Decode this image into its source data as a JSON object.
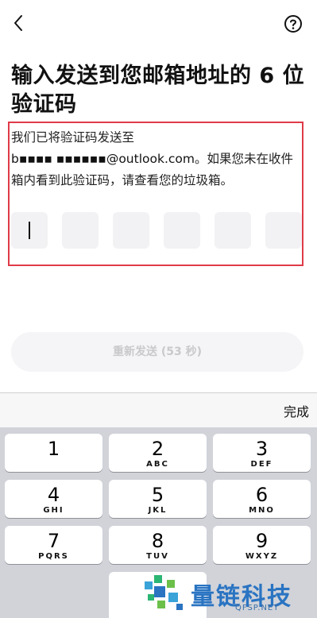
{
  "header": {
    "back_icon": "chevron-left-icon",
    "help_icon": "question-circle-icon"
  },
  "title": "输入发送到您邮箱地址的 6 位验证码",
  "description": {
    "line1": "我们已将验证码发送至",
    "email": "b▪▪▪▪ ▪▪▪▪▪▪@outlook.com",
    "rest": "。如果您未在收件箱内看到此验证码，请查看您的垃圾箱。"
  },
  "otp": {
    "length": 6,
    "values": [
      "",
      "",
      "",
      "",
      "",
      ""
    ],
    "focused_index": 0
  },
  "resend": {
    "label": "重新发送 (53 秒)"
  },
  "keyboard": {
    "done_label": "完成",
    "keys": [
      {
        "num": "1",
        "letters": ""
      },
      {
        "num": "2",
        "letters": "ABC"
      },
      {
        "num": "3",
        "letters": "DEF"
      },
      {
        "num": "4",
        "letters": "GHI"
      },
      {
        "num": "5",
        "letters": "JKL"
      },
      {
        "num": "6",
        "letters": "MNO"
      },
      {
        "num": "7",
        "letters": "PQRS"
      },
      {
        "num": "8",
        "letters": "TUV"
      },
      {
        "num": "9",
        "letters": "WXYZ"
      }
    ]
  },
  "watermark": {
    "text": "量链科技",
    "url": "QFSP.NET"
  },
  "colors": {
    "highlight_border": "#e03a48",
    "otp_box": "#f2f2f4",
    "watermark": "#2a74c2"
  }
}
